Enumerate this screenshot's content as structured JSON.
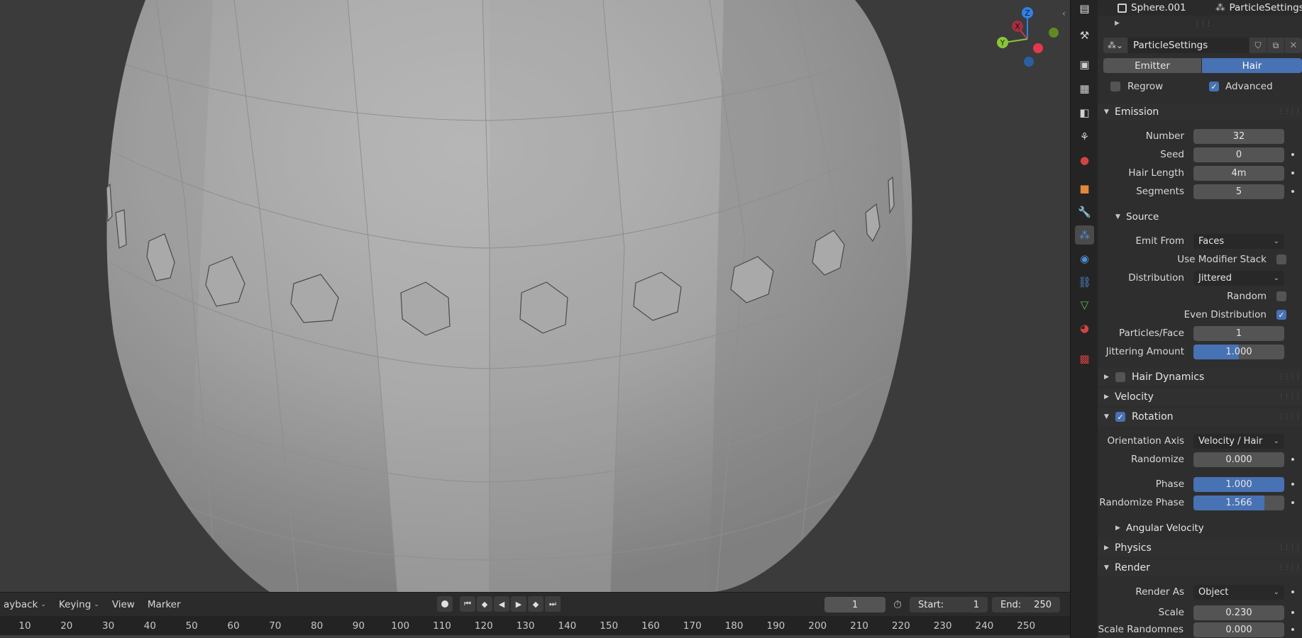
{
  "timeline": {
    "menus": [
      {
        "label": "ayback",
        "dropdown": true
      },
      {
        "label": "Keying",
        "dropdown": true
      },
      {
        "label": "View",
        "dropdown": false
      },
      {
        "label": "Marker",
        "dropdown": false
      }
    ],
    "current_frame": "1",
    "start_label": "Start:",
    "start_value": "1",
    "end_label": "End:",
    "end_value": "250",
    "ruler": [
      "10",
      "20",
      "30",
      "40",
      "50",
      "60",
      "70",
      "80",
      "90",
      "100",
      "110",
      "120",
      "130",
      "140",
      "150",
      "160",
      "170",
      "180",
      "190",
      "200",
      "210",
      "220",
      "230",
      "240",
      "250"
    ]
  },
  "header": {
    "object_name": "Sphere.001",
    "particle_settings_name": "ParticleSettings"
  },
  "particle": {
    "datablock_name": "ParticleSettings",
    "type_emitter": "Emitter",
    "type_hair": "Hair",
    "regrow_label": "Regrow",
    "regrow_checked": false,
    "advanced_label": "Advanced",
    "advanced_checked": true
  },
  "emission": {
    "title": "Emission",
    "number_label": "Number",
    "number": "32",
    "seed_label": "Seed",
    "seed": "0",
    "hair_length_label": "Hair Length",
    "hair_length": "4m",
    "segments_label": "Segments",
    "segments": "5"
  },
  "source": {
    "title": "Source",
    "emit_from_label": "Emit From",
    "emit_from": "Faces",
    "use_modifier_stack_label": "Use Modifier Stack",
    "use_modifier_stack": false,
    "distribution_label": "Distribution",
    "distribution": "Jittered",
    "random_label": "Random",
    "random": false,
    "even_distribution_label": "Even Distribution",
    "even_distribution": true,
    "particles_face_label": "Particles/Face",
    "particles_face": "1",
    "jittering_amount_label": "Jittering Amount",
    "jittering_amount": "1.000",
    "jittering_amount_fraction": 0.5
  },
  "panels": {
    "hair_dynamics": "Hair Dynamics",
    "velocity": "Velocity",
    "rotation": "Rotation",
    "physics": "Physics",
    "render": "Render"
  },
  "rotation": {
    "enabled": true,
    "orientation_axis_label": "Orientation Axis",
    "orientation_axis": "Velocity / Hair",
    "randomize_label": "Randomize",
    "randomize": "0.000",
    "phase_label": "Phase",
    "phase": "1.000",
    "phase_fraction": 1.0,
    "randomize_phase_label": "Randomize Phase",
    "randomize_phase": "1.566",
    "randomize_phase_fraction": 0.783,
    "angular_velocity": "Angular Velocity"
  },
  "render": {
    "render_as_label": "Render As",
    "render_as": "Object",
    "scale_label": "Scale",
    "scale": "0.230",
    "scale_randomness_label": "Scale Randomnes",
    "scale_randomness": "0.000"
  },
  "gizmo": {
    "x": "X",
    "y": "Y",
    "z": "Z"
  },
  "colors": {
    "accent": "#4772b3",
    "x_axis": "#c8394a",
    "y_axis": "#8cc43a",
    "z_axis": "#2e82e6"
  }
}
